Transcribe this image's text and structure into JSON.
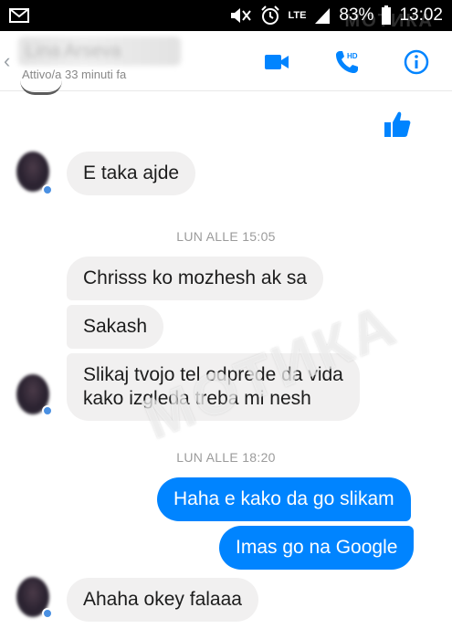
{
  "status_bar": {
    "battery": "83%",
    "time": "13:02",
    "network": "LTE",
    "watermark": "МОТИКА",
    "icons": [
      "mail-icon",
      "mute-icon",
      "alarm-icon",
      "signal-icon",
      "battery-icon"
    ]
  },
  "header": {
    "contact_name": "Lina Arseva",
    "status": "Attivo/a 33 minuti fa",
    "buttons": [
      "video-call-icon",
      "voice-call-hd-icon",
      "info-icon"
    ],
    "hd_badge": "HD",
    "accent_color": "#0084ff"
  },
  "chat": {
    "timestamps": [
      "LUN ALLE 15:05",
      "LUN ALLE 18:20"
    ],
    "messages": [
      {
        "direction": "in",
        "lines": [
          "E taka ajde"
        ]
      },
      {
        "direction": "in",
        "lines": [
          "Chrisss ko mozhesh ak sa"
        ]
      },
      {
        "direction": "in",
        "lines": [
          "Sakash"
        ]
      },
      {
        "direction": "in",
        "lines": [
          "Slikaj tvojo tel odprede da vida",
          "kako izgleda treba mi nesh"
        ]
      },
      {
        "direction": "out",
        "lines": [
          "Haha e kako da go slikam"
        ]
      },
      {
        "direction": "out",
        "lines": [
          "Imas go na Google"
        ]
      },
      {
        "direction": "in",
        "lines": [
          "Ahaha okey falaaa"
        ]
      }
    ],
    "reaction_icon": "thumbs-up-icon",
    "watermark": "МОТИКА",
    "incoming_bubble_color": "#f1f0f0",
    "outgoing_bubble_color": "#0084ff"
  }
}
